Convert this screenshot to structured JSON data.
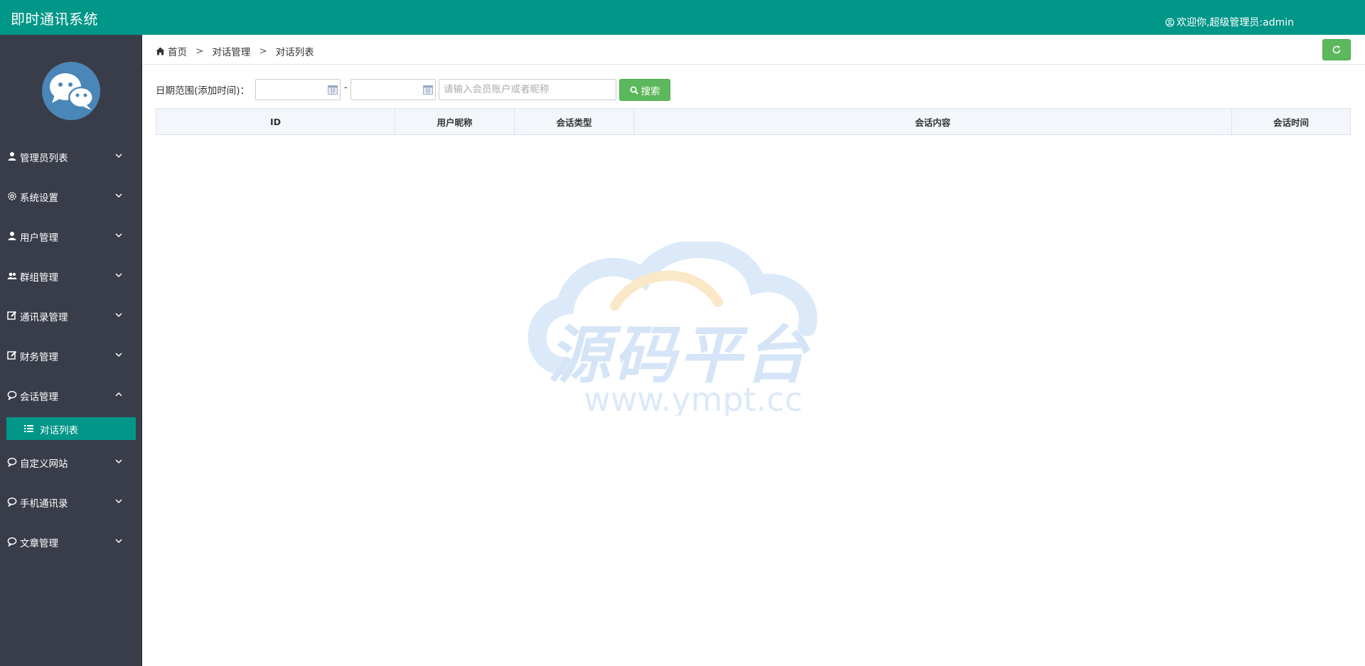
{
  "header": {
    "app_title": "即时通讯系统",
    "welcome_text": "欢迎你,超级管理员:admin",
    "user_icon": "user-circle-icon"
  },
  "sidebar": {
    "logo_icon": "chat-bubbles-icon",
    "items": [
      {
        "label": "管理员列表",
        "icon": "user-icon",
        "expanded": false
      },
      {
        "label": "系统设置",
        "icon": "gear-icon",
        "expanded": false
      },
      {
        "label": "用户管理",
        "icon": "user-icon",
        "expanded": false
      },
      {
        "label": "群组管理",
        "icon": "users-icon",
        "expanded": false
      },
      {
        "label": "通讯录管理",
        "icon": "edit-icon",
        "expanded": false
      },
      {
        "label": "财务管理",
        "icon": "edit-icon",
        "expanded": false
      },
      {
        "label": "会话管理",
        "icon": "comment-icon",
        "expanded": true
      },
      {
        "label": "自定义网站",
        "icon": "comment-icon",
        "expanded": false
      },
      {
        "label": "手机通讯录",
        "icon": "comment-icon",
        "expanded": false
      },
      {
        "label": "文章管理",
        "icon": "comment-icon",
        "expanded": false
      }
    ],
    "active_subitem": {
      "label": "对话列表",
      "icon": "list-icon"
    }
  },
  "breadcrumb": {
    "items": [
      "首页",
      "对话管理",
      "对话列表"
    ],
    "separator": ">"
  },
  "filters": {
    "date_range_label": "日期范围(添加时间)：",
    "start_date": "",
    "end_date": "",
    "range_separator": "-",
    "search_placeholder": "请输入会员账户或者昵称",
    "search_value": "",
    "search_button": "搜索"
  },
  "table": {
    "columns": [
      "ID",
      "用户昵称",
      "会话类型",
      "会话内容",
      "会话时间"
    ],
    "rows": []
  },
  "watermark": {
    "brand": "源码平台",
    "url": "www.ympt.cc"
  },
  "colors": {
    "primary": "#009688",
    "sidebar_bg": "#393d49",
    "button_green": "#5cb85c"
  }
}
